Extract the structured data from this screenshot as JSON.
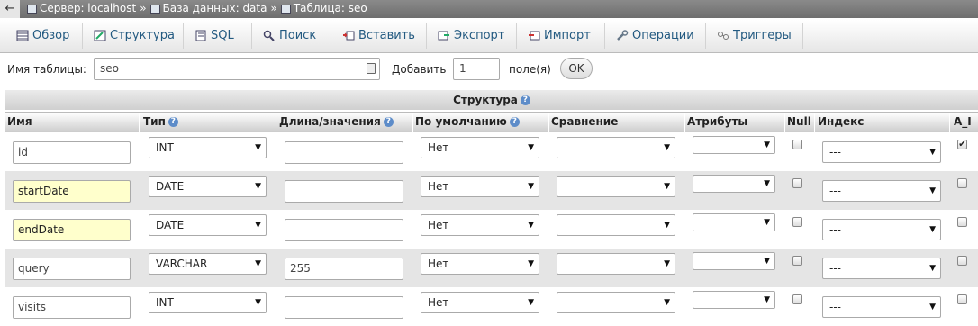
{
  "breadcrumb": {
    "back": "←",
    "server": "Сервер: localhost",
    "database": "База данных: data",
    "table": "Таблица: seo",
    "sep": "»"
  },
  "tabs": [
    {
      "label": "Обзор",
      "icon": "browse-icon"
    },
    {
      "label": "Структура",
      "icon": "structure-icon"
    },
    {
      "label": "SQL",
      "icon": "sql-icon"
    },
    {
      "label": "Поиск",
      "icon": "search-icon"
    },
    {
      "label": "Вставить",
      "icon": "insert-icon"
    },
    {
      "label": "Экспорт",
      "icon": "export-icon"
    },
    {
      "label": "Импорт",
      "icon": "import-icon"
    },
    {
      "label": "Операции",
      "icon": "wrench-icon"
    },
    {
      "label": "Триггеры",
      "icon": "triggers-icon"
    }
  ],
  "table_form": {
    "name_label": "Имя таблицы:",
    "name_value": "seo",
    "add_label": "Добавить",
    "add_count": "1",
    "fields_label": "поле(я)",
    "ok_label": "OK"
  },
  "structure": {
    "title": "Структура",
    "columns": {
      "name": "Имя",
      "type": "Тип",
      "length": "Длина/значения",
      "default": "По умолчанию",
      "collation": "Сравнение",
      "attributes": "Атрибуты",
      "null": "Null",
      "index": "Индекс",
      "ai": "A_I"
    },
    "rows": [
      {
        "name": "id",
        "type": "INT",
        "length": "",
        "default": "Нет",
        "collation": "",
        "attributes": "",
        "null": false,
        "index": "---",
        "ai": true
      },
      {
        "name": "startDate",
        "type": "DATE",
        "length": "",
        "default": "Нет",
        "collation": "",
        "attributes": "",
        "null": false,
        "index": "---",
        "ai": false
      },
      {
        "name": "endDate",
        "type": "DATE",
        "length": "",
        "default": "Нет",
        "collation": "",
        "attributes": "",
        "null": false,
        "index": "---",
        "ai": false
      },
      {
        "name": "query",
        "type": "VARCHAR",
        "length": "255",
        "default": "Нет",
        "collation": "",
        "attributes": "",
        "null": false,
        "index": "---",
        "ai": false
      },
      {
        "name": "visits",
        "type": "INT",
        "length": "",
        "default": "Нет",
        "collation": "",
        "attributes": "",
        "null": false,
        "index": "---",
        "ai": false
      }
    ]
  }
}
